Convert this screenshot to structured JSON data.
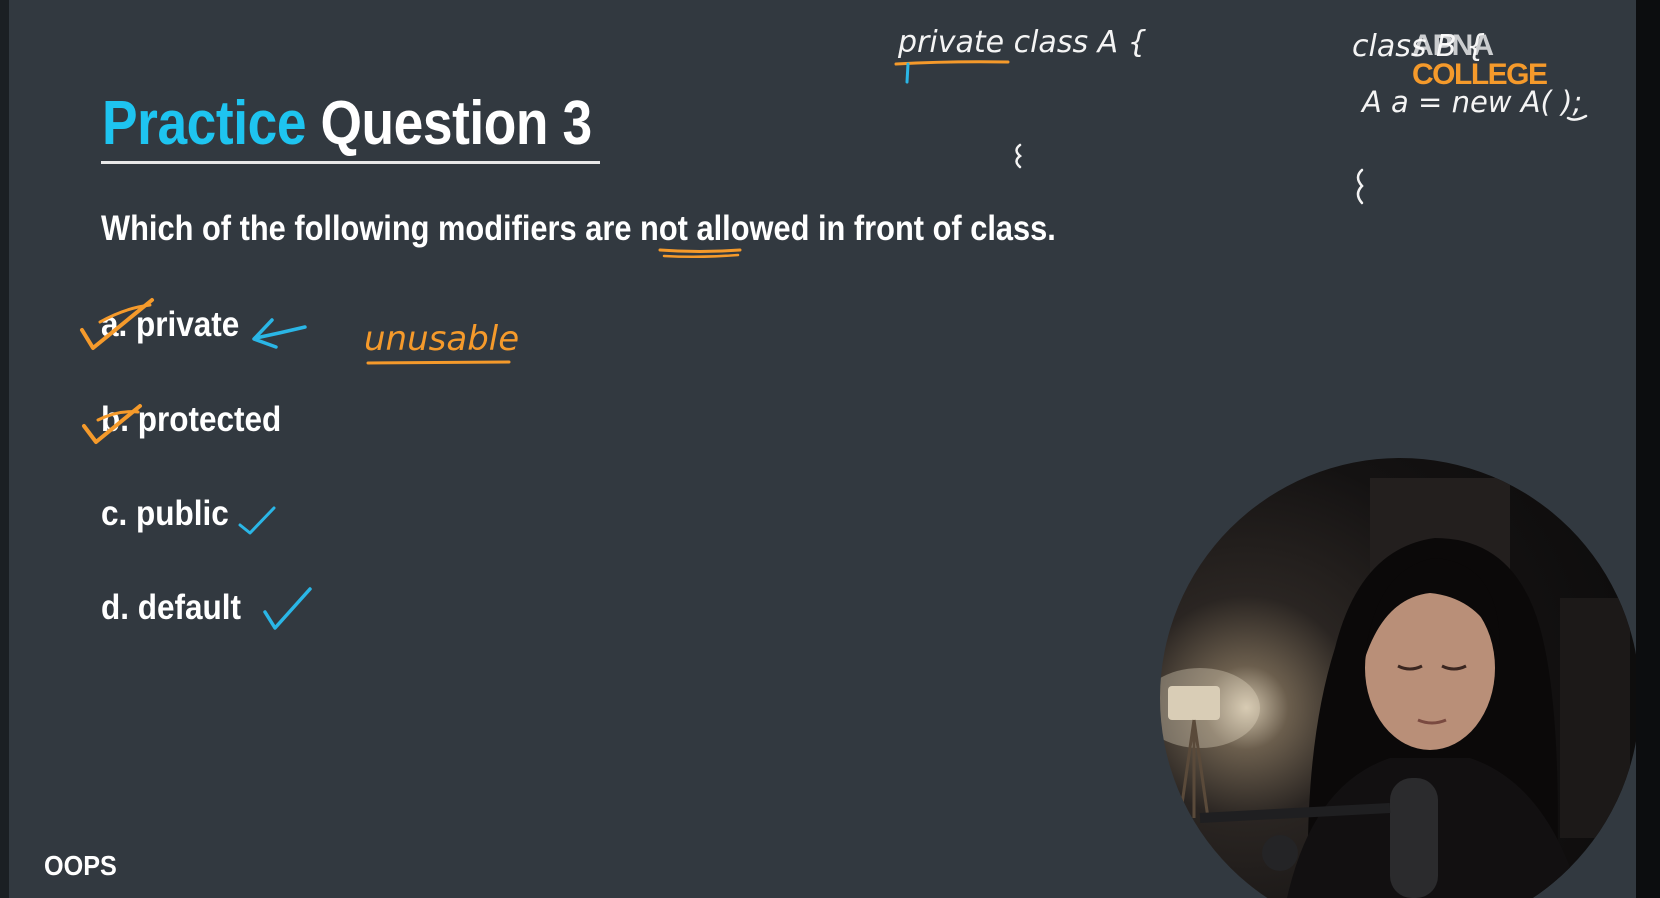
{
  "slide": {
    "title_accent": "Practice",
    "title_rest": "Question 3",
    "question": "Which of the following modifiers are not allowed in front of class.",
    "options": [
      {
        "label": "a. private"
      },
      {
        "label": "b. protected"
      },
      {
        "label": "c. public"
      },
      {
        "label": "d. default"
      }
    ],
    "footer": "OOPS"
  },
  "logo": {
    "line1": "APNA",
    "line2": "COLLEGE"
  },
  "annotations": {
    "note_unusable": "unusable",
    "code_top": "private class A {",
    "code_right_line1": "class B {",
    "code_right_line2": "A a = new A( );",
    "ink_blue": "#2ab6e6",
    "ink_orange": "#f59a2b",
    "ink_white": "#f4f4f4"
  },
  "colors": {
    "background": "#323940",
    "title_accent": "#1ec4f0",
    "text": "#ffffff"
  }
}
